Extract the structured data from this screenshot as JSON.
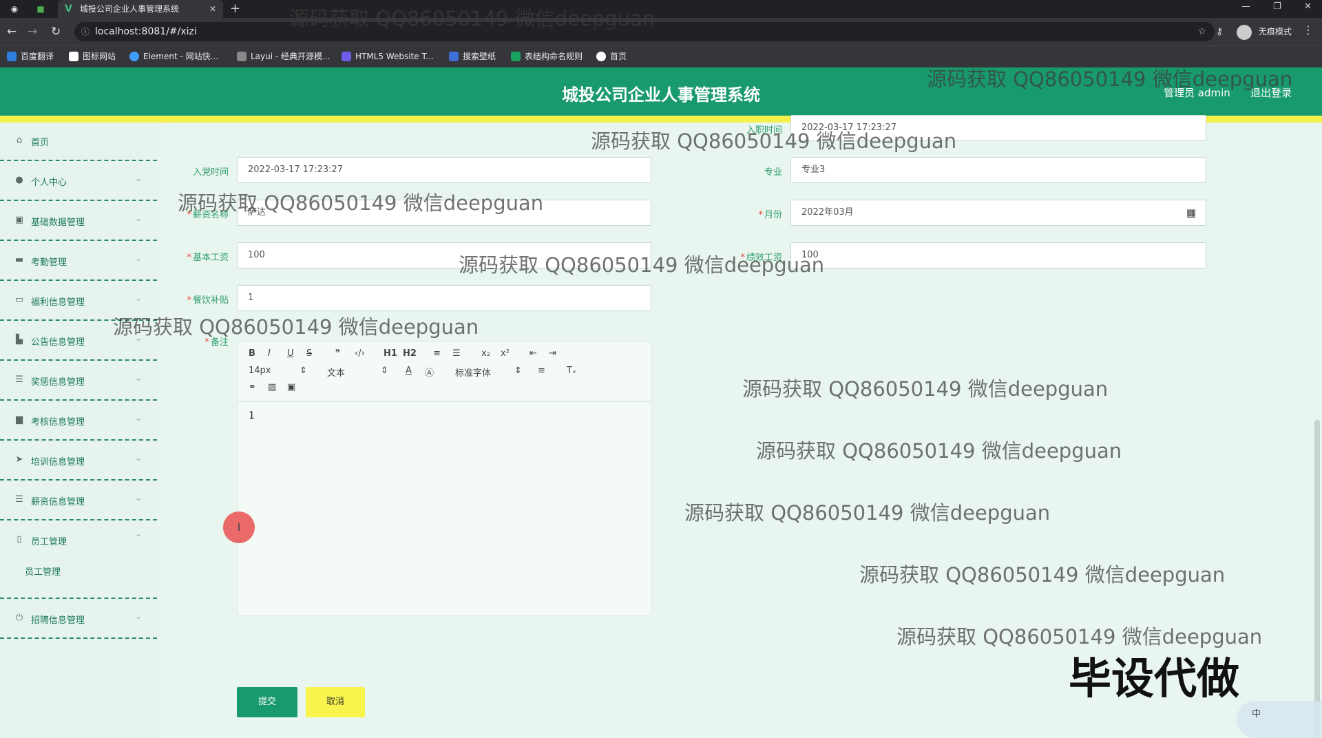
{
  "browser": {
    "tab_title": "城投公司企业人事管理系统",
    "url": "localhost:8081/#/xizi",
    "incognito_label": "无痕模式",
    "bookmarks": [
      "百度翻译",
      "图标网站",
      "Element - 网站快...",
      "Layui - 经典开源模...",
      "HTML5 Website T...",
      "搜索壁纸",
      "表结构命名规则",
      "首页"
    ]
  },
  "header": {
    "title": "城投公司企业人事管理系统",
    "user": "管理员 admin",
    "logout": "退出登录"
  },
  "sidebar": {
    "items": [
      {
        "label": "首页",
        "icon": "home-icon"
      },
      {
        "label": "个人中心",
        "icon": "user-icon"
      },
      {
        "label": "基础数据管理",
        "icon": "data-icon"
      },
      {
        "label": "考勤管理",
        "icon": "attendance-icon"
      },
      {
        "label": "福利信息管理",
        "icon": "welfare-icon"
      },
      {
        "label": "公告信息管理",
        "icon": "notice-icon"
      },
      {
        "label": "奖惩信息管理",
        "icon": "reward-icon"
      },
      {
        "label": "考核信息管理",
        "icon": "assessment-icon"
      },
      {
        "label": "培训信息管理",
        "icon": "training-icon"
      },
      {
        "label": "薪资信息管理",
        "icon": "salary-icon"
      },
      {
        "label": "员工管理",
        "icon": "employee-icon",
        "expanded": true
      },
      {
        "label": "招聘信息管理",
        "icon": "recruit-icon"
      }
    ],
    "sub_item": "员工管理"
  },
  "form": {
    "entry_time": {
      "label": "入职时间",
      "value": "2022-03-17 17:23:27"
    },
    "party_time": {
      "label": "入党时间",
      "value": "2022-03-17 17:23:27"
    },
    "major": {
      "label": "专业",
      "value": "专业3"
    },
    "salary_name": {
      "label": "薪资名称",
      "value": "萨达"
    },
    "month": {
      "label": "月份",
      "value": "2022年03月"
    },
    "base_salary": {
      "label": "基本工资",
      "value": "100"
    },
    "performance_salary": {
      "label": "绩效工资",
      "value": "100"
    },
    "meal_allowance": {
      "label": "餐饮补贴",
      "value": "1"
    },
    "remark": {
      "label": "备注",
      "value": "1"
    },
    "editor_toolbar": {
      "font_size": "14px",
      "paragraph": "文本",
      "font_family": "标准字体",
      "h1": "H1",
      "h2": "H2"
    },
    "submit": "提交",
    "cancel": "取消"
  },
  "watermark_text": "源码获取 QQ86050149 微信deepguan",
  "stamp_text": "毕设代做",
  "ime_label": "中"
}
